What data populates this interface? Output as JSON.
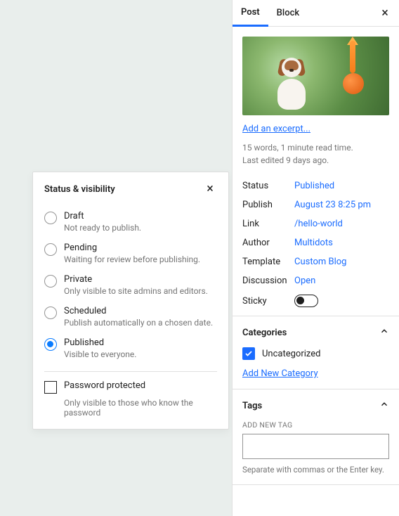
{
  "modal": {
    "title": "Status & visibility",
    "close_label": "×",
    "options": [
      {
        "label": "Draft",
        "desc": "Not ready to publish.",
        "selected": false
      },
      {
        "label": "Pending",
        "desc": "Waiting for review before publishing.",
        "selected": false
      },
      {
        "label": "Private",
        "desc": "Only visible to site admins and editors.",
        "selected": false
      },
      {
        "label": "Scheduled",
        "desc": "Publish automatically on a chosen date.",
        "selected": false
      },
      {
        "label": "Published",
        "desc": "Visible to everyone.",
        "selected": true
      }
    ],
    "password_label": "Password protected",
    "password_desc": "Only visible to those who know the password"
  },
  "sidebar": {
    "tabs": {
      "post": "Post",
      "block": "Block",
      "close": "×"
    },
    "excerpt_link": "Add an excerpt...",
    "meta_line1": "15 words, 1 minute read time.",
    "meta_line2": "Last edited 9 days ago.",
    "details": {
      "status": {
        "label": "Status",
        "value": "Published"
      },
      "publish": {
        "label": "Publish",
        "value": "August 23 8:25 pm"
      },
      "link": {
        "label": "Link",
        "value": "/hello-world"
      },
      "author": {
        "label": "Author",
        "value": "Multidots"
      },
      "template": {
        "label": "Template",
        "value": "Custom Blog"
      },
      "discussion": {
        "label": "Discussion",
        "value": "Open"
      },
      "sticky": {
        "label": "Sticky"
      }
    },
    "categories": {
      "title": "Categories",
      "item1": "Uncategorized",
      "add_link": "Add New Category"
    },
    "tags": {
      "title": "Tags",
      "input_label": "ADD NEW TAG",
      "help": "Separate with commas or the Enter key."
    }
  }
}
